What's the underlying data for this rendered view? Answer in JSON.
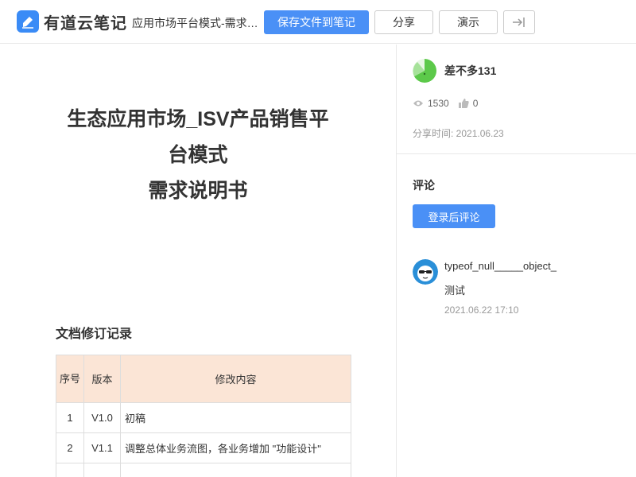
{
  "header": {
    "brand": "有道云笔记",
    "doc_tab": "应用市场平台模式-需求…",
    "save_label": "保存文件到笔记",
    "share_label": "分享",
    "present_label": "演示",
    "icons": {
      "logo": "note-pencil-icon",
      "collapse": "collapse-right-icon"
    },
    "colors": {
      "primary": "#4a90f6"
    }
  },
  "document": {
    "title_line1": "生态应用市场_ISV产品销售平",
    "title_line2": "台模式",
    "title_line3": "需求说明书",
    "revision_heading": "文档修订记录",
    "table": {
      "headers": {
        "no": "序号",
        "version": "版本",
        "content": "修改内容"
      },
      "rows": [
        {
          "no": "1",
          "version": "V1.0",
          "content": "初稿"
        },
        {
          "no": "2",
          "version": "V1.1",
          "content": "调整总体业务流图，各业务增加 \"功能设计\""
        },
        {
          "no": "",
          "version": "",
          "content": ""
        }
      ]
    },
    "header_bg": "#fbe5d6"
  },
  "sidebar": {
    "author": "差不多131",
    "views": "1530",
    "likes": "0",
    "share_time": "分享时间: 2021.06.23",
    "comments_heading": "评论",
    "login_comment_label": "登录后评论",
    "comment": {
      "user": "typeof_null_____object_",
      "text": "测试",
      "time": "2021.06.22 17:10"
    },
    "icons": {
      "views": "eye-icon",
      "likes": "thumbs-up-icon"
    }
  }
}
